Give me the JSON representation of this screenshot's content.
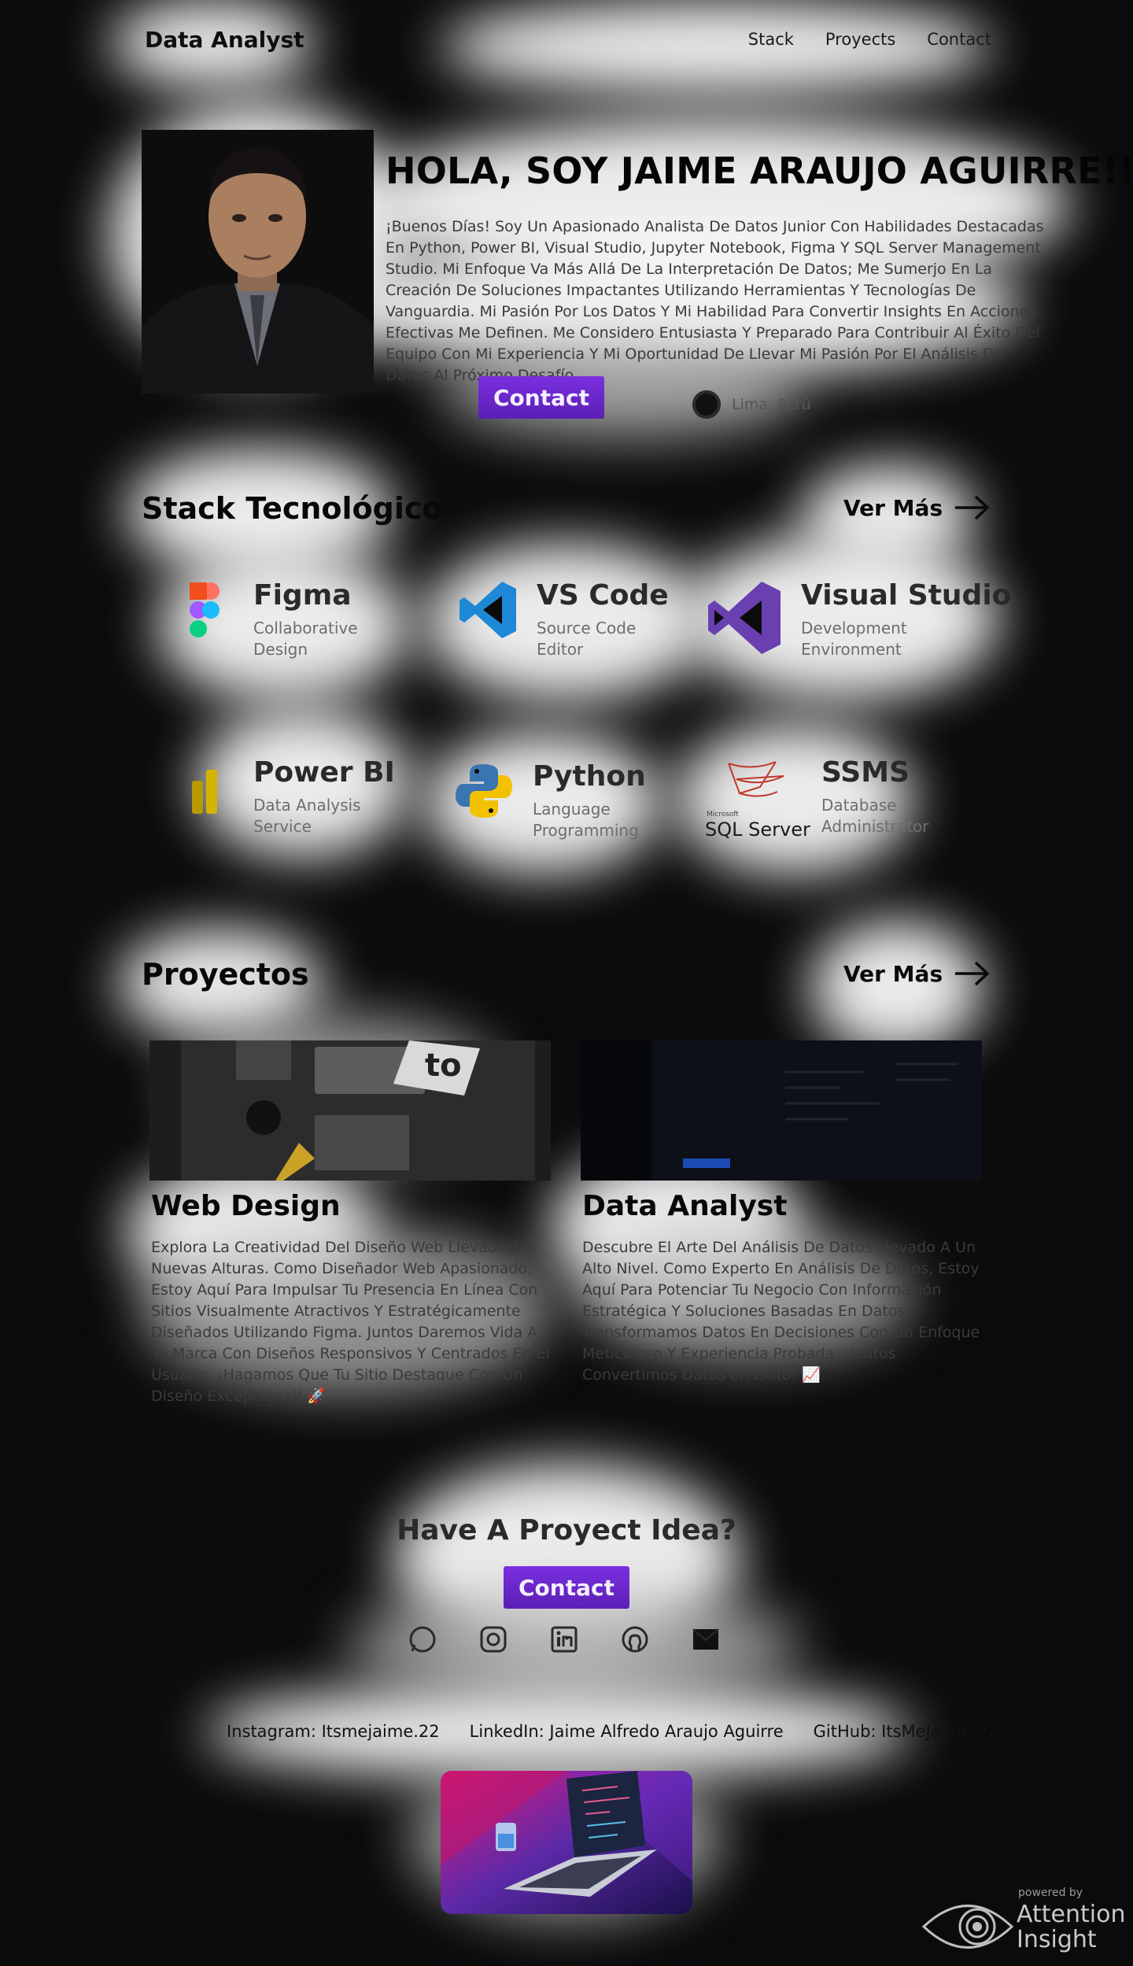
{
  "nav": {
    "brand": "Data Analyst",
    "links": [
      "Stack",
      "Proyects",
      "Contact"
    ]
  },
  "hero": {
    "title": "HOLA, SOY JAIME ARAUJO AGUIRRE!!",
    "text": "¡Buenos Días! Soy Un Apasionado Analista De Datos Junior Con Habilidades Destacadas En Python, Power BI, Visual Studio, Jupyter Notebook, Figma Y SQL Server Management Studio. Mi Enfoque Va Más Allá De La Interpretación De Datos; Me Sumerjo En La Creación De Soluciones Impactantes Utilizando Herramientas Y Tecnologías De Vanguardia. Mi Pasión Por Los Datos Y Mi Habilidad Para Convertir Insights En Acciones Efectivas Me Definen. Me Considero Entusiasta Y Preparado Para Contribuir Al Éxito Del Equipo Con Mi Experiencia Y Mi Oportunidad De Llevar Mi Pasión Por El Análisis De Datos Al Próximo Desafío.",
    "contact_label": "Contact",
    "location": "Lima, Perú"
  },
  "stack": {
    "title": "Stack Tecnológico",
    "more_label": "Ver Más",
    "items": [
      {
        "name": "Figma",
        "desc": "Collaborative Design",
        "icon": "figma-icon"
      },
      {
        "name": "VS Code",
        "desc": "Source Code Editor",
        "icon": "vscode-icon"
      },
      {
        "name": "Visual Studio",
        "desc": "Development Environment",
        "icon": "visual-studio-icon"
      },
      {
        "name": "Power BI",
        "desc": "Data Analysis Service",
        "icon": "power-bi-icon"
      },
      {
        "name": "Python",
        "desc": "Language Programming",
        "icon": "python-icon"
      },
      {
        "name": "SSMS",
        "desc": "Database Administrator",
        "icon": "sql-server-icon",
        "logo_text": "SQL Server",
        "logo_small": "Microsoft"
      }
    ]
  },
  "projects": {
    "title": "Proyectos",
    "more_label": "Ver Más",
    "items": [
      {
        "title": "Web Design",
        "text": "Explora La Creatividad Del Diseño Web Llevado A Nuevas Alturas. Como Diseñador Web Apasionado, Estoy Aquí Para Impulsar Tu Presencia En Línea Con Sitios Visualmente Atractivos Y Estratégicamente Diseñados Utilizando Figma. Juntos Daremos Vida A Tu Marca Con Diseños Responsivos Y Centrados En El Usuario. ¡Hagamos Que Tu Sitio Destaque Con Un Diseño Excepcional! 🚀"
      },
      {
        "title": "Data Analyst",
        "text": "Descubre El Arte Del Análisis De Datos Llevado A Un Alto Nivel. Como Experto En Análisis De Datos, Estoy Aquí Para Potenciar Tu Negocio Con Información Estratégica Y Soluciones Basadas En Datos. Transformamos Datos En Decisiones Con Un Enfoque Meticuloso Y Experiencia Probada. ¡Juntos Convertimos Datos En Éxito! 📈"
      }
    ]
  },
  "cta": {
    "title": "Have A Proyect Idea?",
    "contact_label": "Contact",
    "socials": [
      "whatsapp-icon",
      "instagram-icon",
      "linkedin-icon",
      "github-icon",
      "mail-icon"
    ]
  },
  "footer_links": [
    "Instagram: Itsmejaime.22",
    "LinkedIn: Jaime Alfredo Araujo Aguirre",
    "GitHub: ItsMeJaime-22"
  ],
  "badge": {
    "powered": "powered by",
    "brand_line1": "Attention",
    "brand_line2": "Insight"
  },
  "colors": {
    "accent": "#6a28cc",
    "background": "#0b0b0c"
  }
}
